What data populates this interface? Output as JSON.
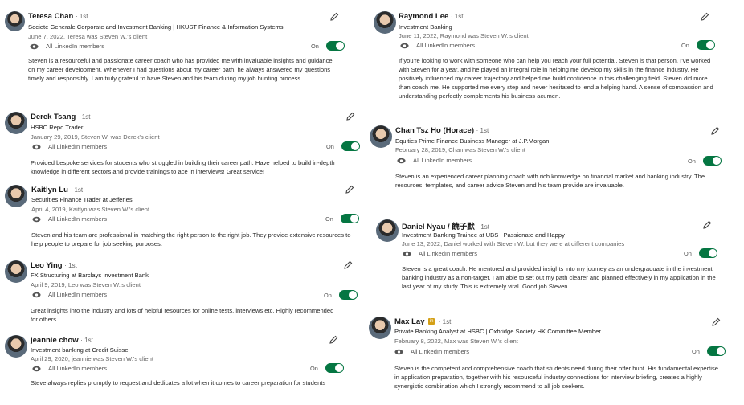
{
  "recommendations": [
    {
      "name": "Teresa Chan",
      "degree": "· 1st",
      "headline": "Societe Generale Corporate and Investment Banking | HKUST Finance & Information Systems",
      "meta": "June 7, 2022, Teresa was Steven W.'s client",
      "visibility": "All LinkedIn members",
      "toggle_label": "On",
      "text": "Steven is a resourceful and passionate career coach who has provided me with invaluable insights and guidance on my career development. Whenever I had questions about my career path, he always answered my questions timely and responsibly. I am truly grateful to have Steven and his team during my job hunting process.",
      "avatar": "avatar-icon"
    },
    {
      "name": "Derek Tsang",
      "degree": "· 1st",
      "headline": "HSBC Repo Trader",
      "meta": "January 29, 2019, Steven W. was Derek's client",
      "visibility": "All LinkedIn members",
      "toggle_label": "On",
      "text": "Provided bespoke services for students who struggled in building their career path. Have helped to build in-depth knowledge in different sectors and provide trainings to ace in interviews! Great service!",
      "avatar": "avatar-icon"
    },
    {
      "name": "Kaitlyn Lu",
      "degree": "· 1st",
      "headline": "Securities Finance Trader at Jefferies",
      "meta": "April 4, 2019, Kaitlyn was Steven W.'s client",
      "visibility": "All LinkedIn members",
      "toggle_label": "On",
      "text": "Steven and his team are professional in matching the right person to the right job. They provide extensive resources to help people to prepare for job seeking purposes.",
      "avatar": "avatar-icon"
    },
    {
      "name": "Leo Ying",
      "degree": "· 1st",
      "headline": "FX Structuring at Barclays Investment Bank",
      "meta": "April 9, 2019, Leo was Steven W.'s client",
      "visibility": "All LinkedIn members",
      "toggle_label": "On",
      "text": "Great insights into the industry and lots of helpful resources for online tests, interviews etc. Highly recommended for others.",
      "avatar": "avatar-icon"
    },
    {
      "name": "jeannie chow",
      "degree": "· 1st",
      "headline": "Investment banking at Credit Suisse",
      "meta": "April 29, 2020, jeannie was Steven W.'s client",
      "visibility": "All LinkedIn members",
      "toggle_label": "On",
      "text": "Steve always replies promptly to request and dedicates a lot when it comes to career preparation for students",
      "avatar": "avatar-icon"
    },
    {
      "name": "Raymond Lee",
      "degree": "· 1st",
      "headline": "Investment Banking",
      "meta": "June 11, 2022, Raymond was Steven W.'s client",
      "visibility": "All LinkedIn members",
      "toggle_label": "On",
      "text": "If you're looking to work with someone who can help you reach your full potential, Steven is that person. I've worked with Steven for a year, and he played an integral role in helping me develop my skills in the finance industry. He positively influenced my career trajectory and helped me build confidence in this challenging field. Steven did more than coach me. He supported me every step and never hesitated to lend a helping hand. A sense of compassion and understanding perfectly complements his business acumen.",
      "avatar": "avatar-icon"
    },
    {
      "name": "Chan Tsz Ho (Horace)",
      "degree": "· 1st",
      "headline": "Equities Prime Finance Business Manager at J.P.Morgan",
      "meta": "February 28, 2019, Chan was Steven W.'s client",
      "visibility": "All LinkedIn members",
      "toggle_label": "On",
      "text": "Steven is an experienced career planning coach with rich knowledge on financial market and banking industry. The resources, templates, and career advice Steven and his team provide are invaluable.",
      "avatar": "avatar-icon"
    },
    {
      "name": "Daniel Nyau / 饒子默",
      "degree": "· 1st",
      "headline": "Investment Banking Trainee at UBS | Passionate and Happy",
      "meta": "June 13, 2022, Daniel worked with Steven W. but they were at different companies",
      "visibility": "All LinkedIn members",
      "toggle_label": "On",
      "text": "Steven is a great coach. He mentored and provided insights into my journey as an undergraduate in the investment banking industry as a non-target. I am able to set out my path clearer and planned effectively in my application in the last year of my study. This is extremely vital. Good job Steven.",
      "avatar": "avatar-icon"
    },
    {
      "name": "Max Lay",
      "degree": "· 1st",
      "headline": "Private Banking Analyst at HSBC | Oxbridge Society HK Committee Member",
      "meta": "February 8, 2022, Max was Steven W.'s client",
      "visibility": "All LinkedIn members",
      "toggle_label": "On",
      "text": "Steven is the competent and comprehensive coach that students need during their offer hunt. His fundamental expertise in application preparation, together with his resourceful industry connections for interview briefing, creates a highly synergistic combination which I strongly recommend to all job seekers.",
      "avatar": "avatar-icon",
      "badge": "in"
    }
  ],
  "icons": {
    "eye": "eye-icon",
    "edit": "pencil-icon",
    "toggle": "toggle-icon"
  },
  "colors": {
    "toggle_on": "#057642",
    "meta_text": "#666666",
    "badge": "#d4a017"
  }
}
